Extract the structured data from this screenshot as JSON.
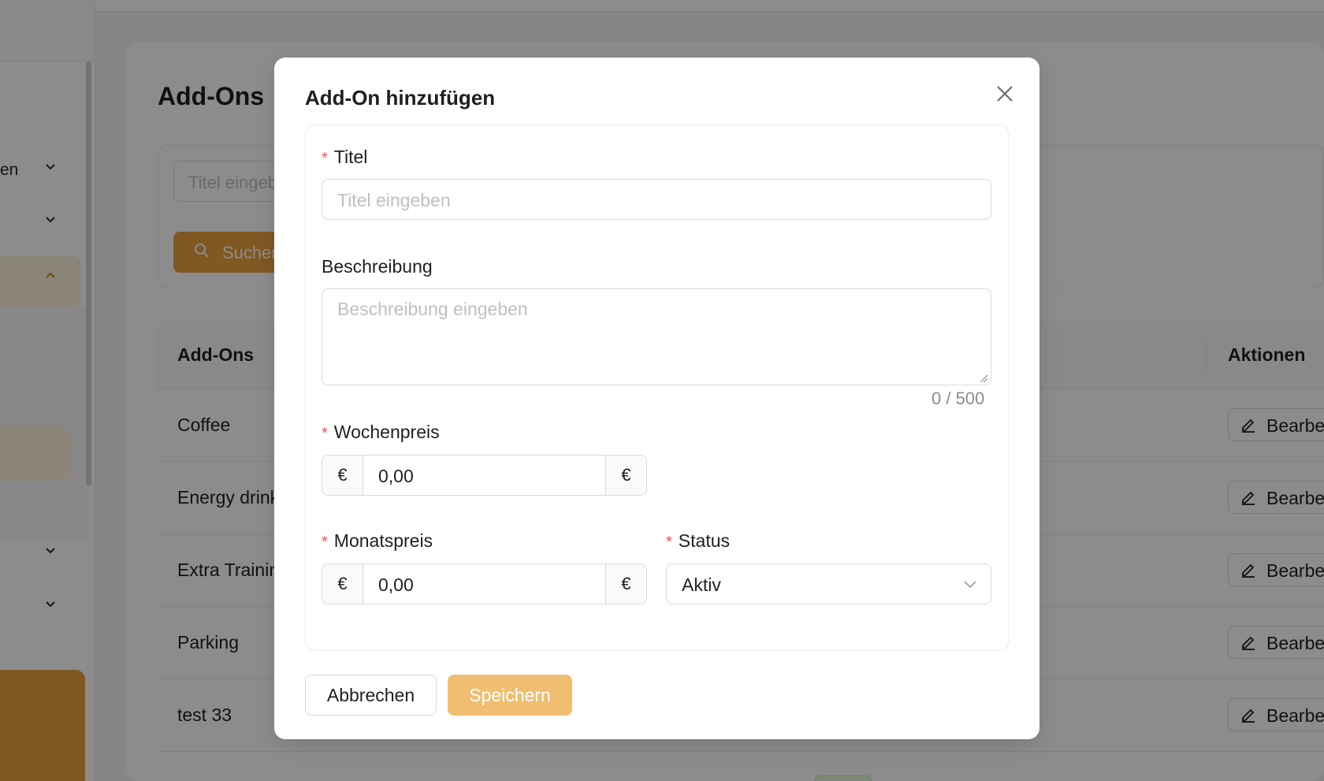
{
  "background": {
    "page_title": "Add-Ons",
    "sidebar": {
      "items": [
        {
          "label": "en",
          "chevron": "chevron-down"
        },
        {
          "label": "",
          "chevron": "chevron-down"
        },
        {
          "label": "",
          "chevron": "chevron-up"
        },
        {
          "label": "",
          "chevron": "chevron-down"
        },
        {
          "label": "",
          "chevron": "chevron-down"
        }
      ]
    },
    "filter": {
      "search_placeholder": "Titel eingeben",
      "search_button": "Suchen"
    },
    "table": {
      "columns": [
        "Add-Ons",
        "Aktionen"
      ],
      "rows": [
        "Coffee",
        "Energy drink",
        "Extra Training",
        "Parking",
        "test 33"
      ],
      "edit_label": "Bearbeiten"
    }
  },
  "modal": {
    "title": "Add-On hinzufügen",
    "close_icon": "close-icon",
    "required_mark": "*",
    "fields": {
      "title": {
        "label": "Titel",
        "placeholder": "Titel eingeben",
        "value": ""
      },
      "description": {
        "label": "Beschreibung",
        "placeholder": "Beschreibung eingeben",
        "value": "",
        "counter": "0 / 500"
      },
      "weekly_price": {
        "label": "Wochenpreis",
        "prefix": "€",
        "value": "0,00",
        "suffix": "€"
      },
      "monthly_price": {
        "label": "Monatspreis",
        "prefix": "€",
        "value": "0,00",
        "suffix": "€"
      },
      "status": {
        "label": "Status",
        "value": "Aktiv"
      }
    },
    "buttons": {
      "cancel": "Abbrechen",
      "save": "Speichern"
    }
  },
  "colors": {
    "accent": "#e8a03e",
    "save_button": "#f0be70",
    "required": "#ff4d4f",
    "overlay": "rgba(0,0,0,0.45)"
  }
}
